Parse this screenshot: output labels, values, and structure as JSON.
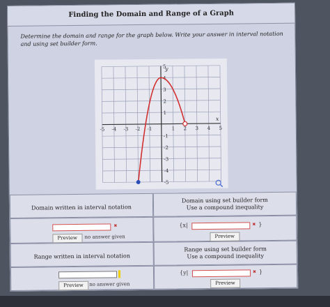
{
  "header": {
    "title": "Finding the Domain and Range of a Graph"
  },
  "prompt": {
    "text": "Determine the domain and range for the graph below. Write your answer in interval notation and using set builder form."
  },
  "graph": {
    "x_ticks": [
      "-5",
      "-4",
      "-3",
      "-2",
      "-1",
      "1",
      "2",
      "3",
      "4",
      "5"
    ],
    "y_ticks": [
      "5",
      "4",
      "3",
      "2",
      "1",
      "-1",
      "-2",
      "-3",
      "-4",
      "-5"
    ],
    "x_axis_label": "x",
    "y_axis_label": "y",
    "x_range": [
      -5,
      5
    ],
    "y_range": [
      -5,
      5
    ],
    "curve_color": "#d23030",
    "closed_point": {
      "x": -2,
      "y": -5,
      "color": "#2a4db8"
    },
    "open_point": {
      "x": 2,
      "y": 0
    }
  },
  "domain_interval": {
    "label": "Domain written in interval notation",
    "value": "",
    "preview_label": "Preview",
    "status": "no answer given"
  },
  "domain_set": {
    "label_line1": "Domain using set builder form",
    "label_line2": "Use a compound inequality",
    "open": "{x|",
    "close": "}",
    "value": "",
    "preview_label": "Preview"
  },
  "range_interval": {
    "label": "Range written in interval notation",
    "value": "",
    "preview_label": "Preview",
    "status": "no answer given"
  },
  "range_set": {
    "label_line1": "Range using set builder form",
    "label_line2": "Use a compound inequality",
    "open": "{y|",
    "close": "}",
    "value": "",
    "preview_label": "Preview"
  },
  "icons": {
    "magnifier": "magnifier-icon",
    "error": "x-mark-icon"
  }
}
